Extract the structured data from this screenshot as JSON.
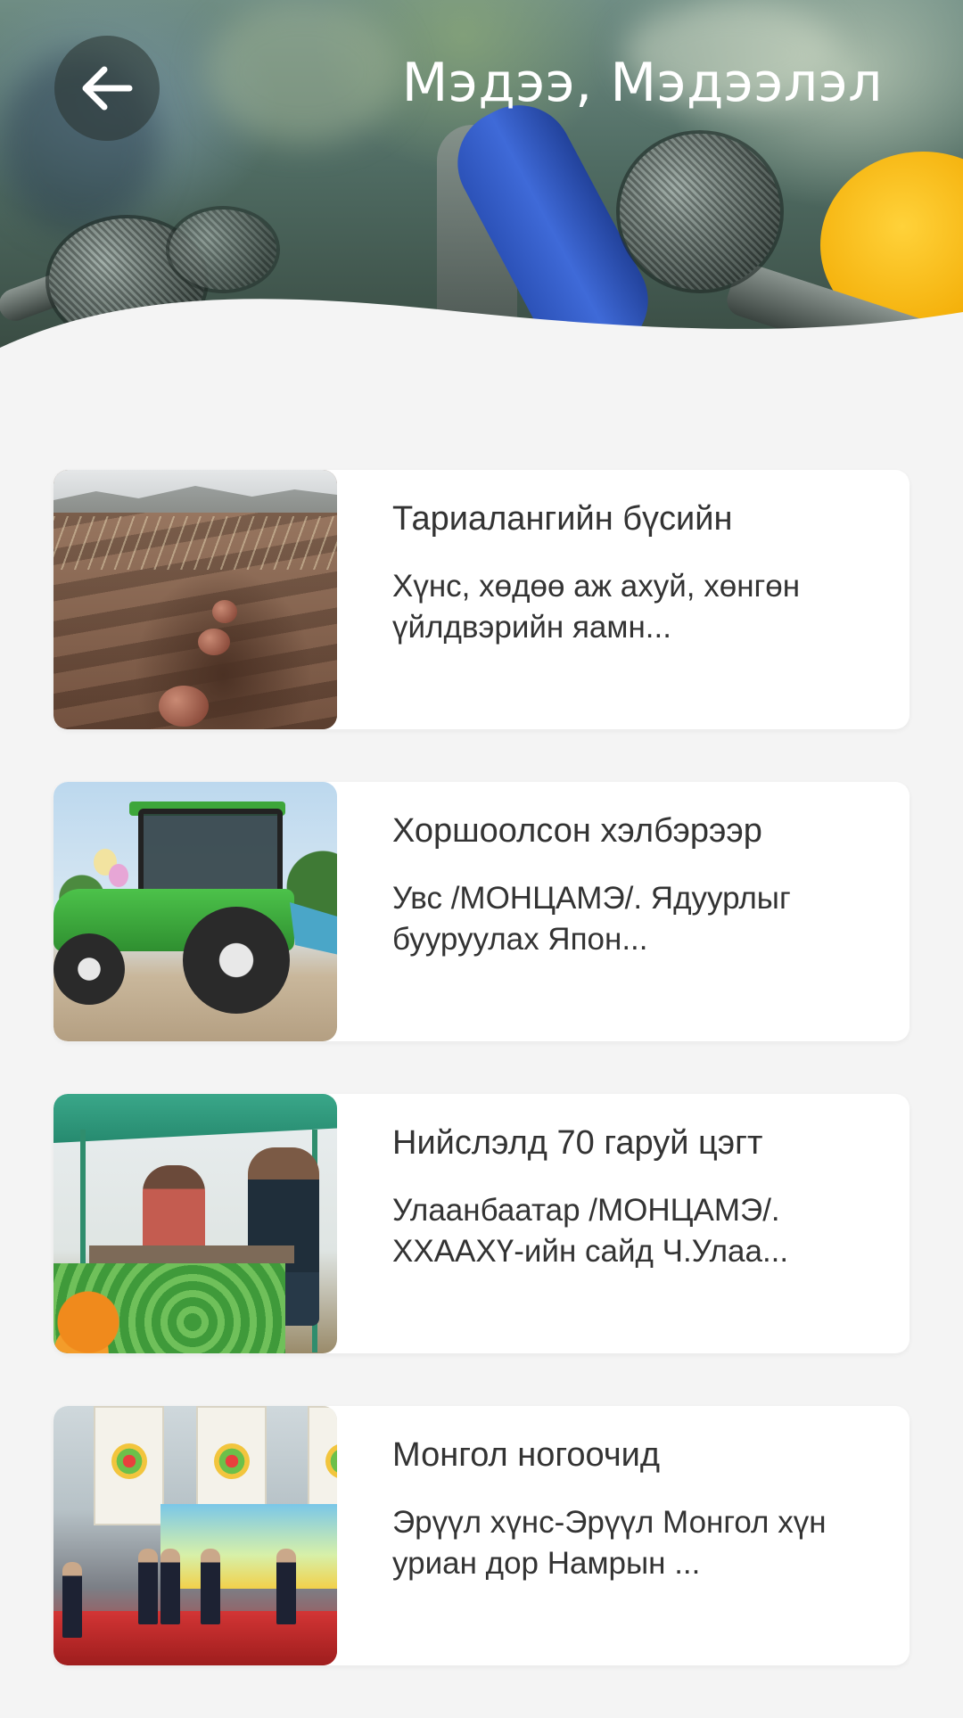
{
  "header": {
    "title": "Мэдээ, Мэдээлэл",
    "back_icon": "arrow-left-icon"
  },
  "news": [
    {
      "title": "Тариалангийн бүсийн",
      "summary": "Хүнс, хөдөө аж ахуй, хөнгөн үйлдвэрийн яамн...",
      "thumbnail": "potato-field-photo"
    },
    {
      "title": "Хоршоолсон хэлбэрээр",
      "summary": "Увс /МОНЦАМЭ/. Ядуурлыг бууруулах Япон...",
      "thumbnail": "tractor-photo"
    },
    {
      "title": "Нийслэлд 70 гаруй цэгт",
      "summary": "Улаанбаатар /МОНЦАМЭ/. ХХААХҮ-ийн сайд Ч.Улаа...",
      "thumbnail": "vegetable-market-photo"
    },
    {
      "title": "Монгол ногоочид",
      "summary": "Эрүүл хүнс-Эрүүл Монгол хүн уриан дор  Намрын ...",
      "thumbnail": "exhibition-event-photo"
    }
  ],
  "colors": {
    "background": "#f4f4f4",
    "card": "#ffffff",
    "text": "#333333",
    "header_text": "#ffffff"
  }
}
